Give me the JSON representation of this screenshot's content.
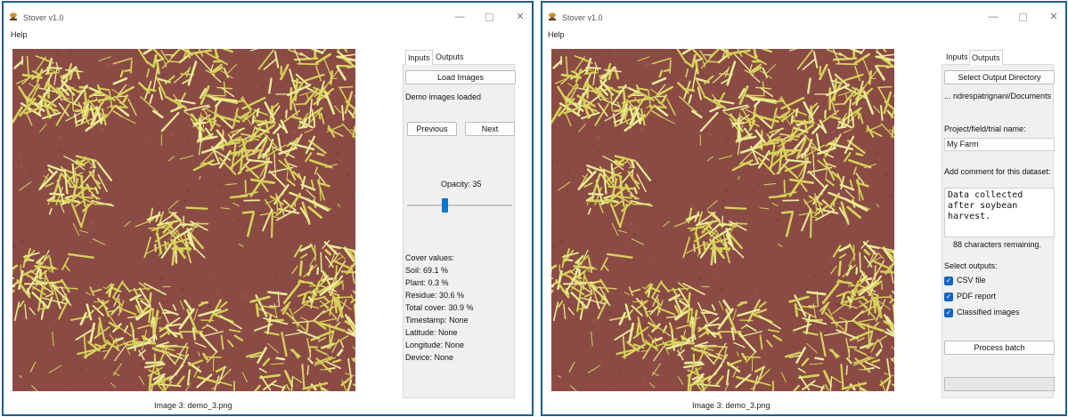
{
  "app": {
    "title": "Stover v1.0",
    "menu_help": "Help"
  },
  "colors": {
    "soil": "#8a4b45",
    "residue": "#d6d25a",
    "accent": "#0078d4",
    "window_border": "#1f5f8b"
  },
  "window_controls": {
    "minimize": "—",
    "close": "✕"
  },
  "image_caption": "Image 3: demo_3.png",
  "inputs_tab": {
    "tab_inputs": "Inputs",
    "tab_outputs": "Outputs",
    "load_images": "Load Images",
    "status": "Demo images loaded",
    "previous": "Previous",
    "next": "Next",
    "opacity_label": "Opacity: 35",
    "opacity_value": 35,
    "cover_title": "Cover values:",
    "soil": "Soil: 69.1 %",
    "plant": "Plant: 0.3 %",
    "residue": "Residue: 30.6 %",
    "total_cover": "Total cover: 30.9 %",
    "timestamp": "Timestamp: None",
    "latitude": "Latitude: None",
    "longitude": "Longitude: None",
    "device": "Device: None"
  },
  "outputs_tab": {
    "tab_inputs": "Inputs",
    "tab_outputs": "Outputs",
    "select_dir": "Select Output Directory",
    "dir_path": "... ndrespatrignani/Documents",
    "project_label": "Project/field/trial name:",
    "project_value": "My Farm",
    "comment_label": "Add comment for this dataset:",
    "comment_value": "Data collected after soybean harvest.",
    "chars_remaining": "88 characters remaining.",
    "select_outputs": "Select outputs:",
    "csv": "CSV file",
    "pdf": "PDF report",
    "classified": "Classified images",
    "csv_checked": true,
    "pdf_checked": true,
    "classified_checked": true,
    "process_batch": "Process batch",
    "progress": 0
  }
}
